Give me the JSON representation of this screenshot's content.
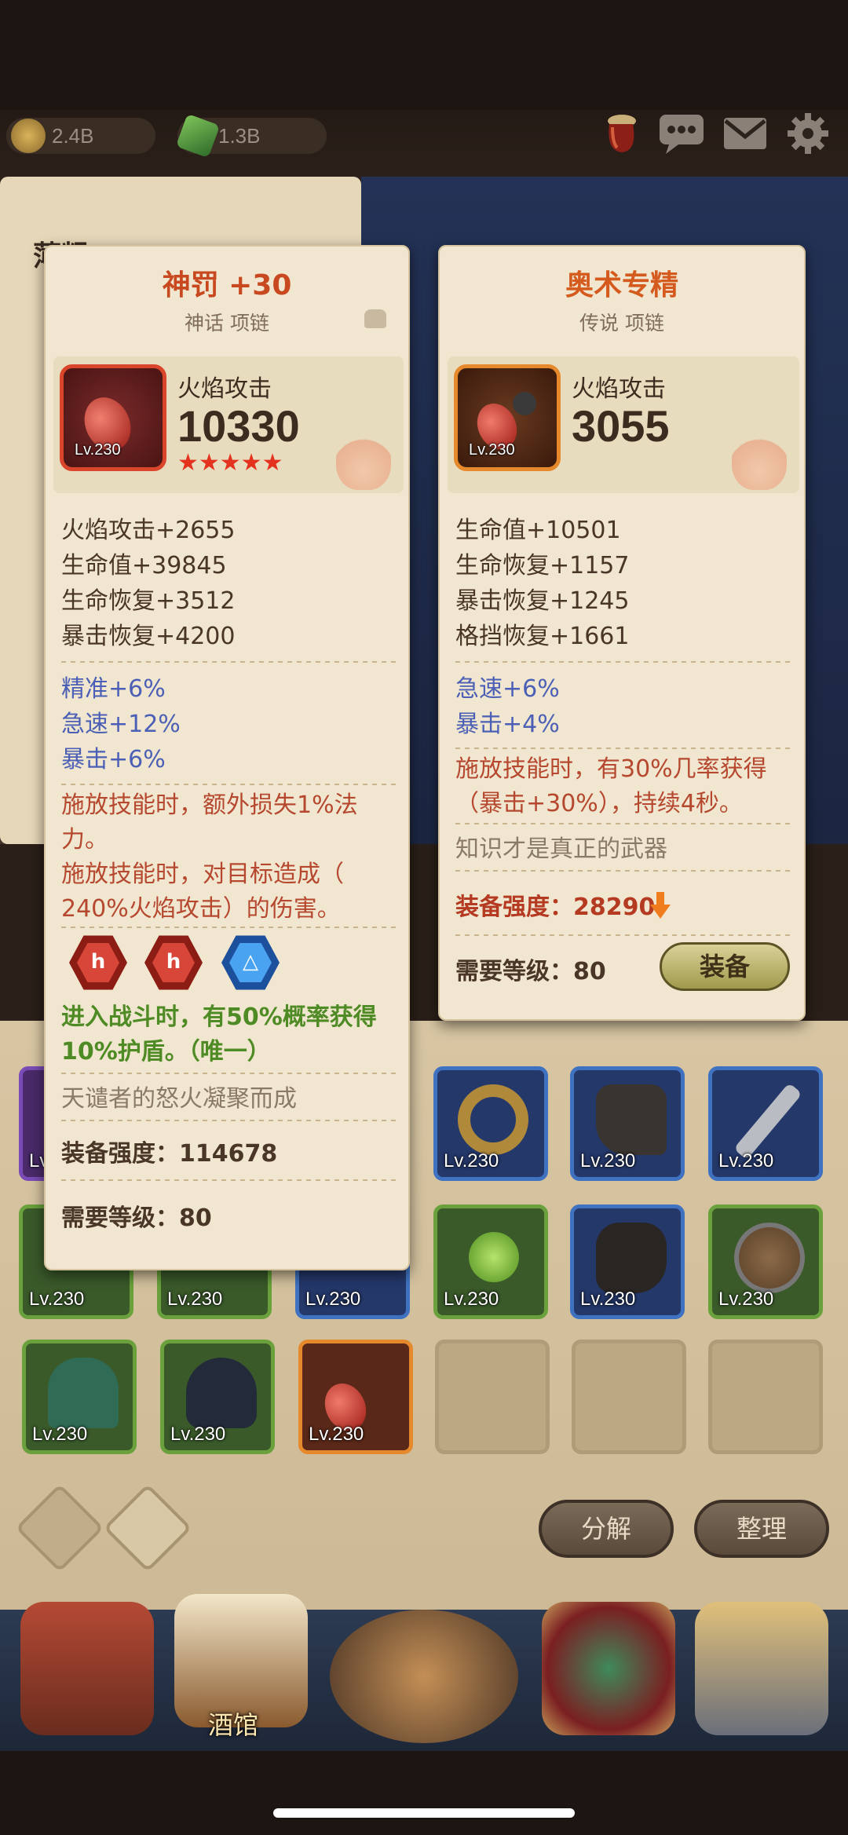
{
  "topbar": {
    "gold": "2.4B",
    "gems": "1.3B",
    "icons": [
      "potion-icon",
      "chat-icon",
      "mail-icon",
      "gear-icon"
    ]
  },
  "bg_card": {
    "title_partial": "薄粗"
  },
  "item_left": {
    "name": "神罚 +30",
    "rarity": "神话 项链",
    "main_label": "火焰攻击",
    "main_value": "10330",
    "level": "Lv.230",
    "stars": "★★★★★",
    "stats": [
      "火焰攻击+2655",
      "生命值+39845",
      "生命恢复+3512",
      "暴击恢复+4200"
    ],
    "bonus": [
      "精准+6%",
      "急速+12%",
      "暴击+6%"
    ],
    "effect_1": "施放技能时，额外损失1%法",
    "effect_1b": "力。",
    "effect_2": "施放技能时，对目标造成（",
    "effect_2b": "240%火焰攻击）的伤害。",
    "gems": [
      "h",
      "h",
      "△"
    ],
    "gem_effect_1": "进入战斗时，有50%概率获得",
    "gem_effect_2": "10%护盾。（唯一）",
    "flavor": "天谴者的怒火凝聚而成",
    "power": "装备强度：114678",
    "req_level": "需要等级：80"
  },
  "item_right": {
    "name": "奥术专精",
    "rarity": "传说 项链",
    "main_label": "火焰攻击",
    "main_value": "3055",
    "level": "Lv.230",
    "stats": [
      "生命值+10501",
      "生命恢复+1157",
      "暴击恢复+1245",
      "格挡恢复+1661"
    ],
    "bonus": [
      "急速+6%",
      "暴击+4%"
    ],
    "effect_1": "施放技能时，有30%几率获得",
    "effect_2": "（暴击+30%），持续4秒。",
    "flavor": "知识才是真正的武器",
    "power": "装备强度：28290",
    "req_level": "需要等级：80",
    "equip_label": "装备"
  },
  "inventory": {
    "slot_level": "Lv.230",
    "decompose_label": "分解",
    "sort_label": "整理"
  },
  "nav": {
    "tavern_label": "酒馆"
  },
  "colors": {
    "title_red": "#c8491f",
    "stat_blue": "#4a5fb5",
    "effect_red": "#b5482f",
    "gem_green": "#4f8b25"
  }
}
